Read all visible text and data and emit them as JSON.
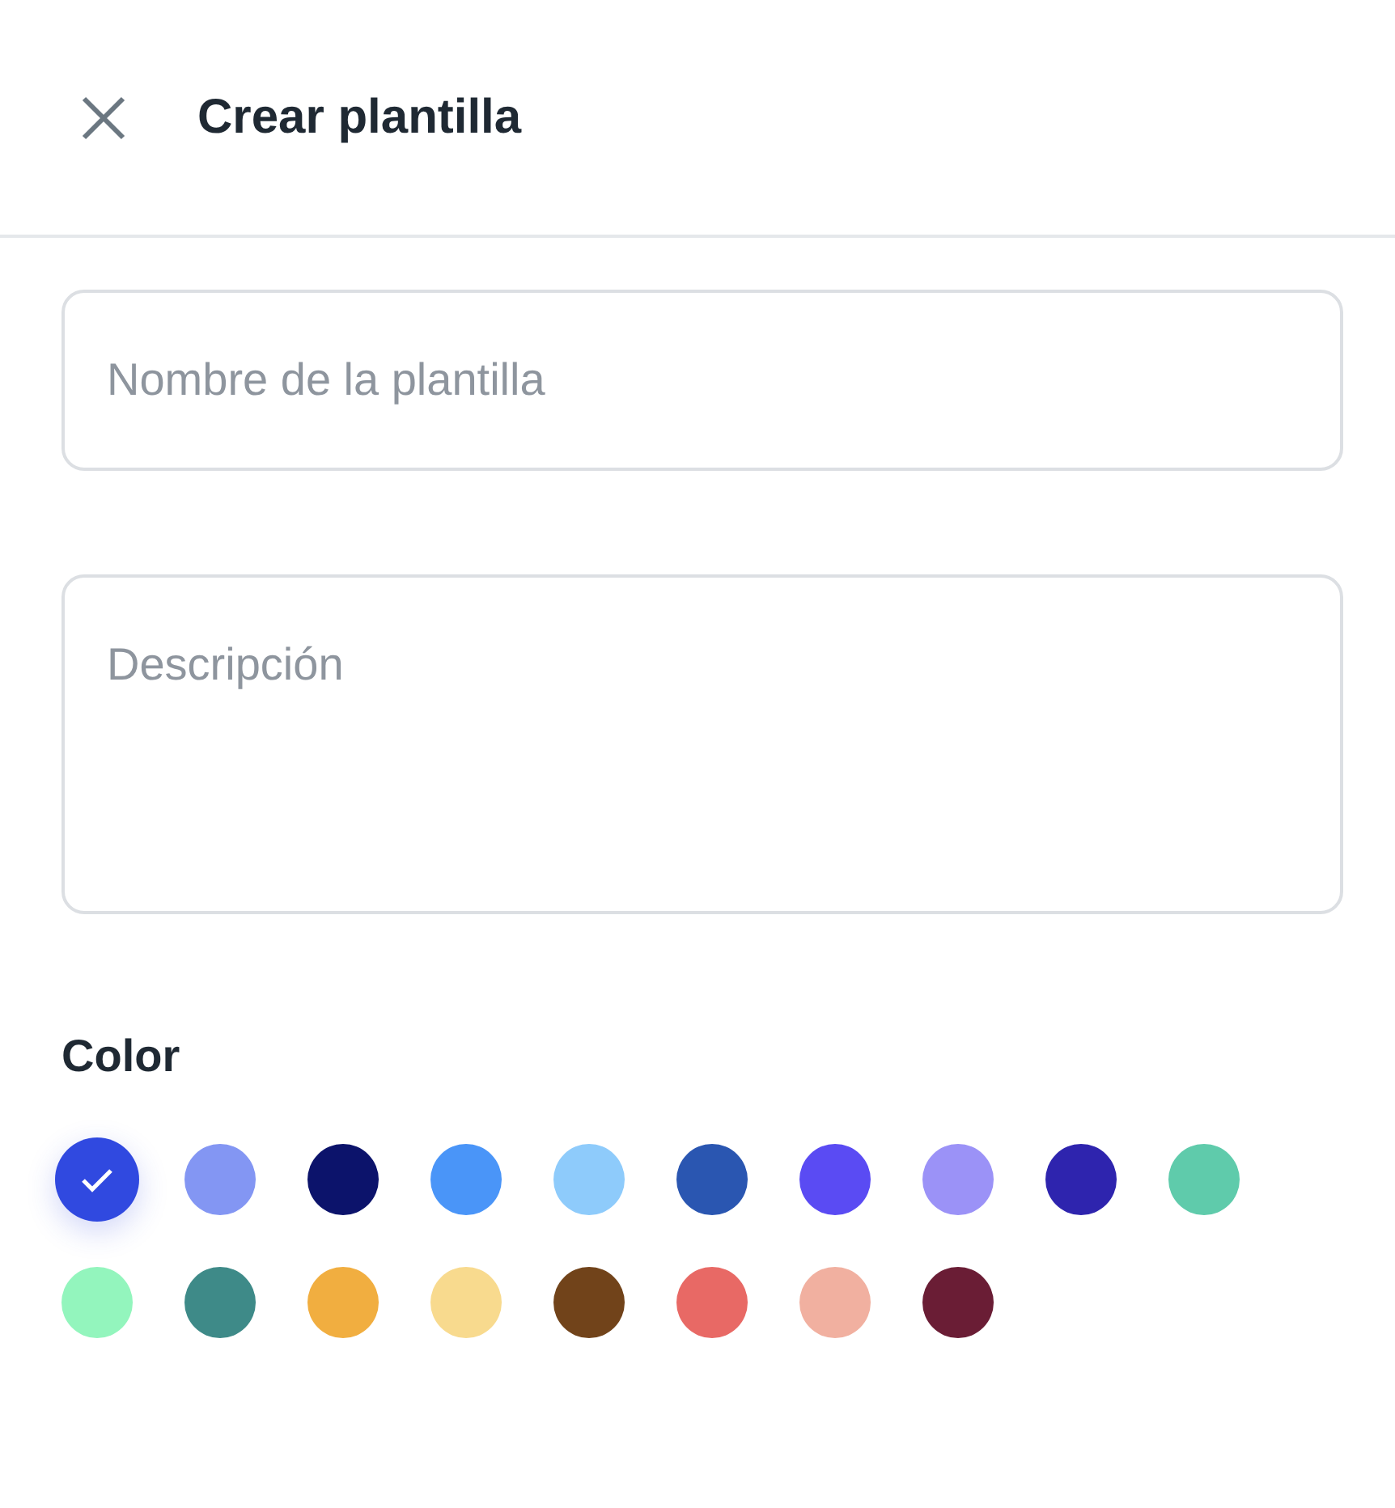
{
  "header": {
    "title": "Crear plantilla"
  },
  "form": {
    "name_field": {
      "placeholder": "Nombre de la plantilla"
    },
    "description_field": {
      "placeholder": "Descripción"
    }
  },
  "color_picker": {
    "label": "Color",
    "swatches": [
      {
        "color": "#3049e0",
        "selected": true
      },
      {
        "color": "#8396f3",
        "selected": false
      },
      {
        "color": "#0c136b",
        "selected": false
      },
      {
        "color": "#4a95f8",
        "selected": false
      },
      {
        "color": "#8ecbfb",
        "selected": false
      },
      {
        "color": "#2a56b1",
        "selected": false
      },
      {
        "color": "#5a4bf3",
        "selected": false
      },
      {
        "color": "#9b92f7",
        "selected": false
      },
      {
        "color": "#2e24ae",
        "selected": false
      },
      {
        "color": "#5fcbab",
        "selected": false
      },
      {
        "color": "#93f5bd",
        "selected": false
      },
      {
        "color": "#3e8a88",
        "selected": false
      },
      {
        "color": "#f1ae40",
        "selected": false
      },
      {
        "color": "#f8da8e",
        "selected": false
      },
      {
        "color": "#71431a",
        "selected": false
      },
      {
        "color": "#e86965",
        "selected": false
      },
      {
        "color": "#f1b0a0",
        "selected": false
      },
      {
        "color": "#6a1d35",
        "selected": false
      }
    ]
  }
}
